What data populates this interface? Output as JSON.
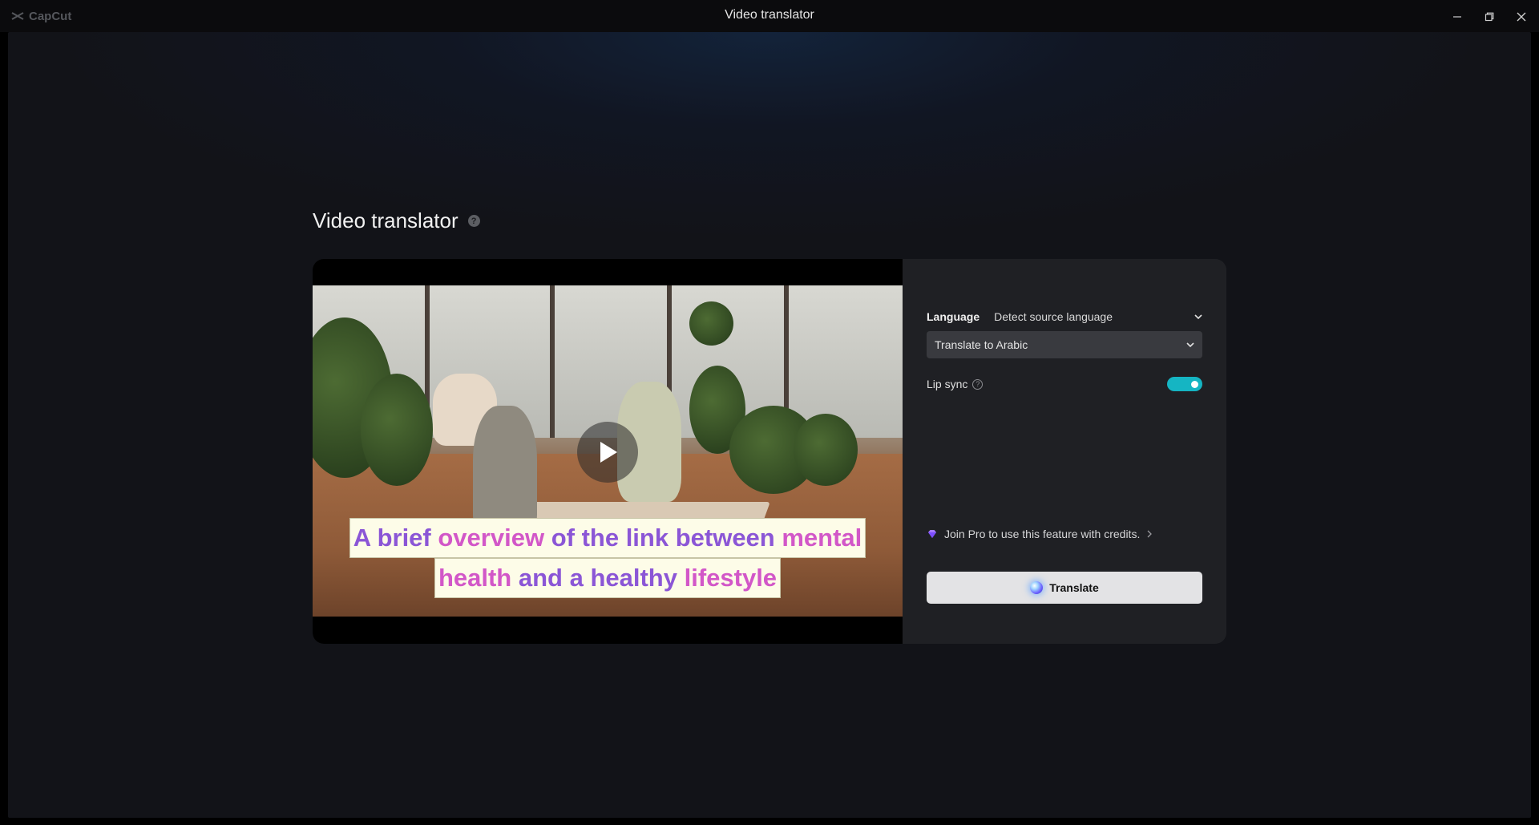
{
  "window": {
    "brand": "CapCut",
    "title": "Video translator"
  },
  "page": {
    "title": "Video translator"
  },
  "video": {
    "caption_line1": [
      "A brief",
      "overview",
      "of the link between",
      "mental"
    ],
    "caption_line2": [
      "health",
      "and a healthy",
      "lifestyle"
    ],
    "caption_colors": {
      "primary": "#8b56d6",
      "highlight": "#d257c8",
      "background": "#fdfce8"
    }
  },
  "settings": {
    "language_label": "Language",
    "source_language": "Detect source language",
    "target_language": "Translate to Arabic",
    "lip_sync_label": "Lip sync",
    "lip_sync_enabled": true,
    "pro_text": "Join Pro to use this feature with credits.",
    "translate_button": "Translate"
  },
  "colors": {
    "accent_toggle": "#15b5c3",
    "button_bg": "#e3e3e5"
  },
  "icons": [
    "capcut-logo-icon",
    "minimize-icon",
    "maximize-icon",
    "close-icon",
    "help-icon",
    "play-icon",
    "chevron-down-icon",
    "info-icon",
    "gem-icon",
    "chevron-right-icon",
    "ai-orb-icon"
  ]
}
